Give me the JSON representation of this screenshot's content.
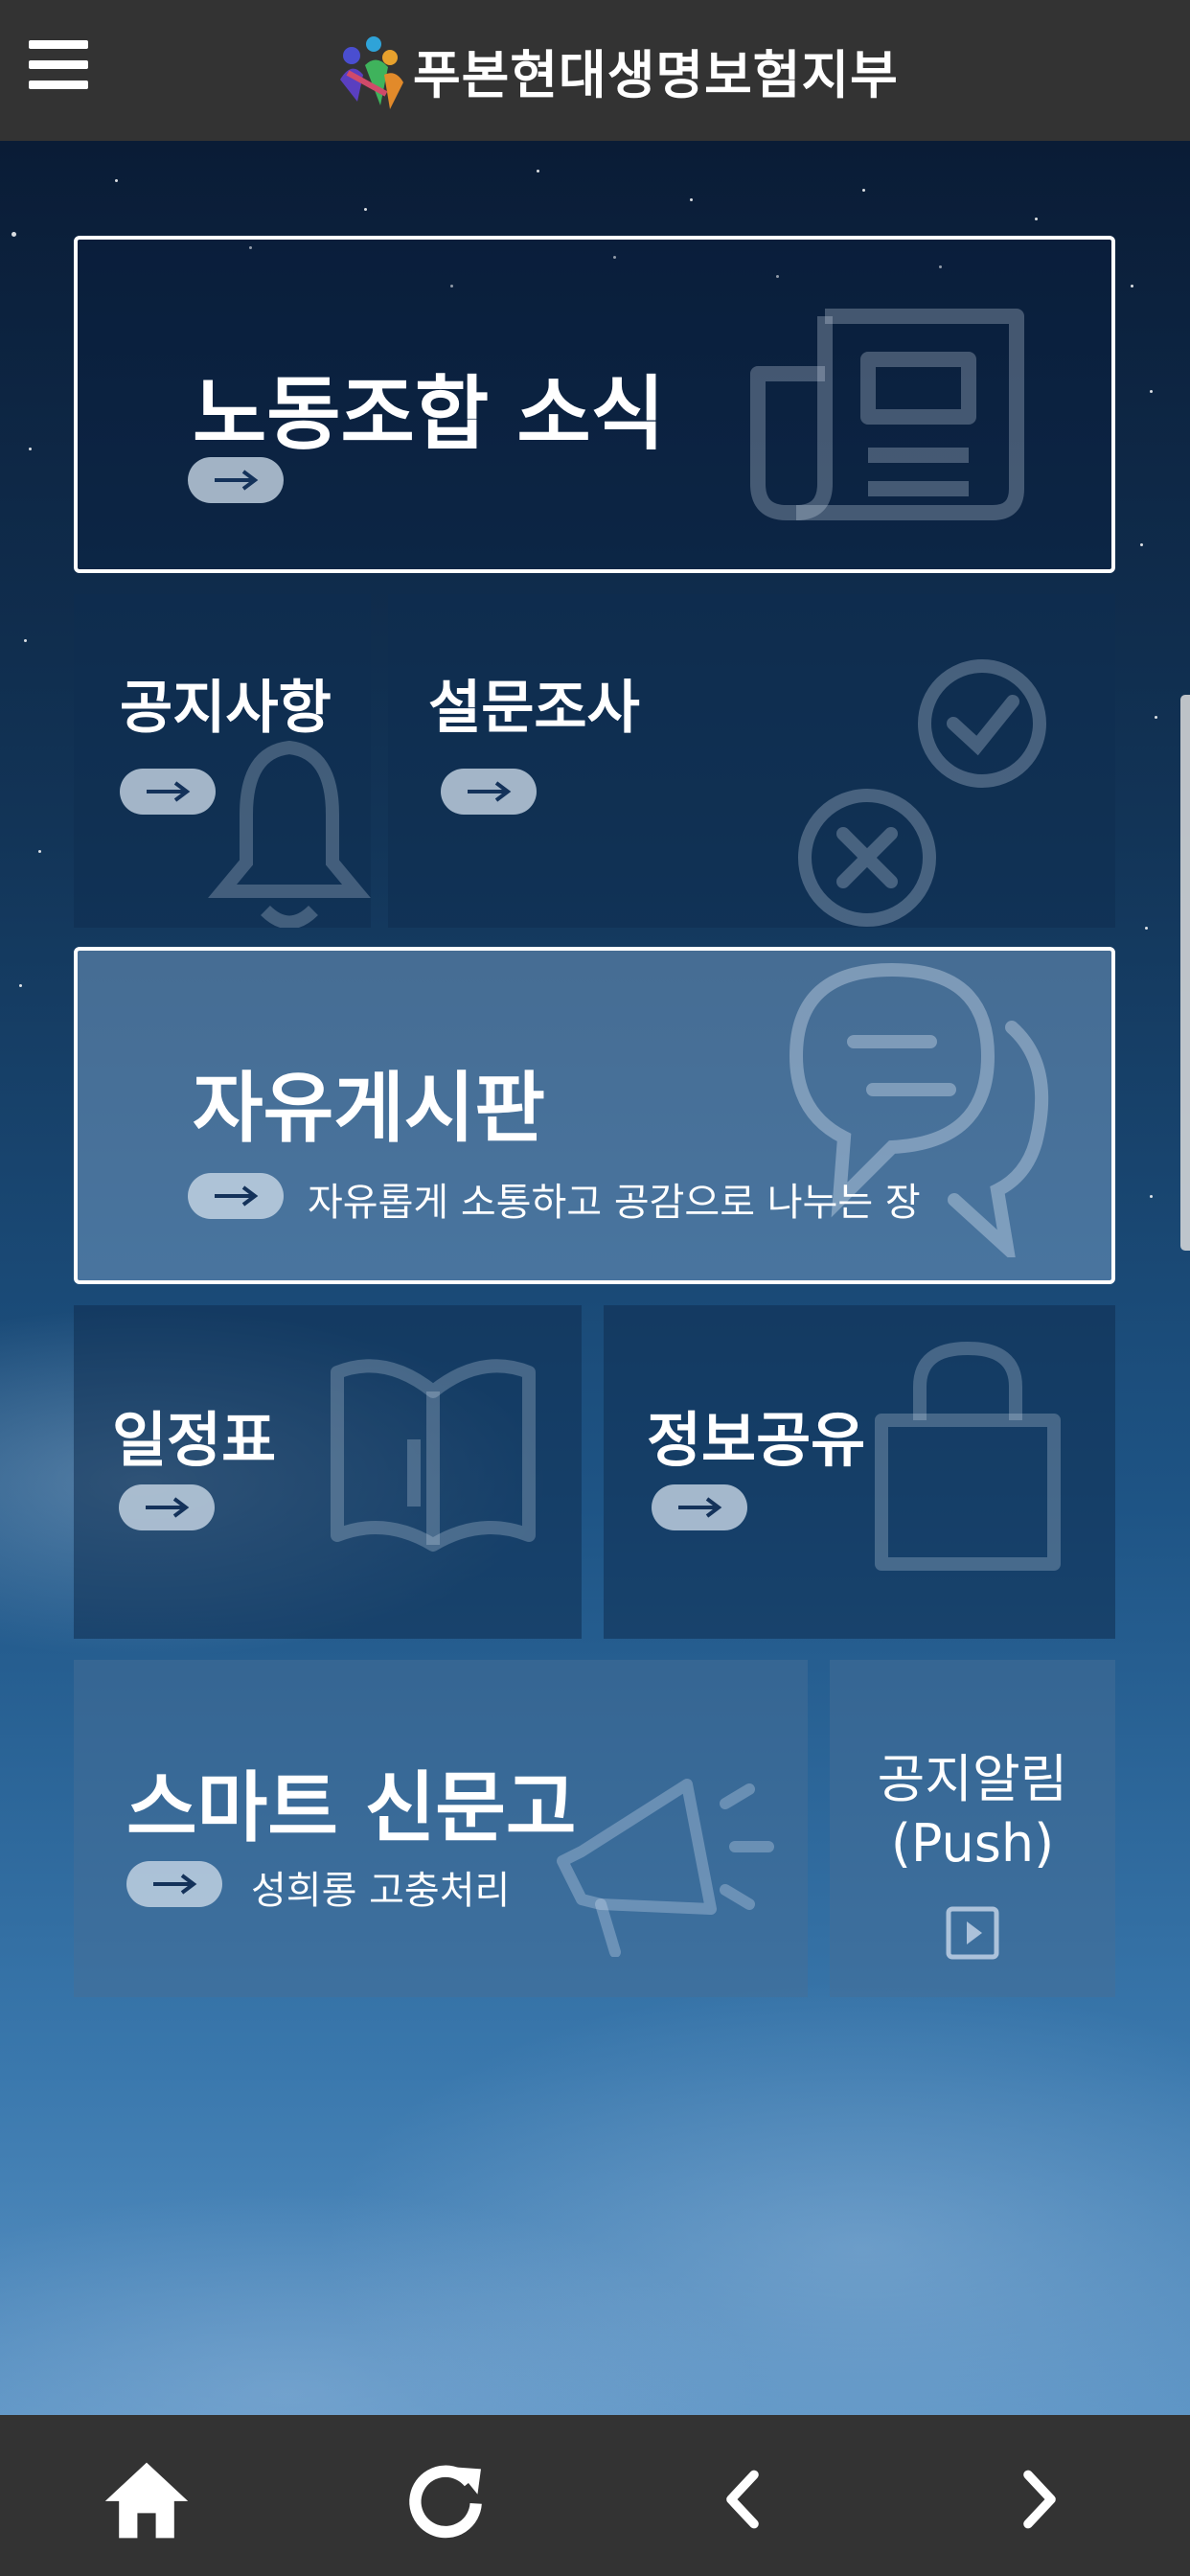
{
  "header": {
    "title": "푸본현대생명보험지부",
    "menu_icon": "hamburger-menu-icon",
    "logo_icon": "union-logo-icon"
  },
  "tiles": {
    "union_news": {
      "title": "노동조합 소식",
      "icon": "newspaper-icon"
    },
    "notice": {
      "title": "공지사항",
      "icon": "bell-icon"
    },
    "survey": {
      "title": "설문조사",
      "icon": "check-cross-icon"
    },
    "free_board": {
      "title": "자유게시판",
      "subtitle": "자유롭게 소통하고 공감으로 나누는 장",
      "icon": "chat-bubble-icon"
    },
    "schedule": {
      "title": "일정표",
      "icon": "book-icon"
    },
    "info_share": {
      "title": "정보공유",
      "icon": "bag-icon"
    },
    "smart_report": {
      "title": "스마트 신문고",
      "subtitle": "성희롱 고충처리",
      "icon": "megaphone-icon"
    },
    "push_notice": {
      "title_line1": "공지알림",
      "title_line2": "(Push)",
      "icon": "play-square-icon"
    }
  },
  "bottom_nav": {
    "home": "home-icon",
    "refresh": "refresh-icon",
    "back": "chevron-left-icon",
    "forward": "chevron-right-icon"
  },
  "colors": {
    "bar": "#333333",
    "border": "#ffffff",
    "pill": "#c8d7e6"
  }
}
